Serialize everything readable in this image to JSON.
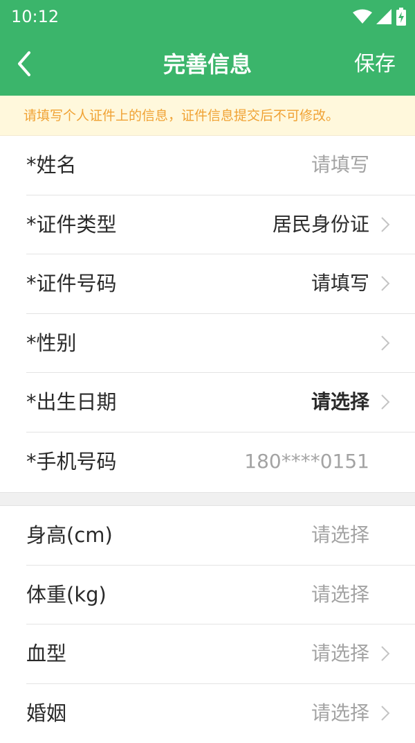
{
  "status_bar": {
    "time": "10:12"
  },
  "header": {
    "title": "完善信息",
    "save_label": "保存"
  },
  "notice": "请填写个人证件上的信息，证件信息提交后不可修改。",
  "section1": [
    {
      "label": "*姓名",
      "value": "请填写",
      "style": "placeholder",
      "chevron": false
    },
    {
      "label": "*证件类型",
      "value": "居民身份证",
      "style": "dark",
      "chevron": true
    },
    {
      "label": "*证件号码",
      "value": "请填写",
      "style": "dark",
      "chevron": true
    },
    {
      "label": "*性别",
      "value": "",
      "style": "placeholder",
      "chevron": true
    },
    {
      "label": "*出生日期",
      "value": "请选择",
      "style": "bold",
      "chevron": true
    },
    {
      "label": "*手机号码",
      "value": "180****0151",
      "style": "placeholder",
      "chevron": false
    }
  ],
  "section2": [
    {
      "label": "身高(cm)",
      "value": "请选择",
      "style": "placeholder",
      "chevron": false
    },
    {
      "label": "体重(kg)",
      "value": "请选择",
      "style": "placeholder",
      "chevron": false
    },
    {
      "label": "血型",
      "value": "请选择",
      "style": "placeholder",
      "chevron": true
    },
    {
      "label": "婚姻",
      "value": "请选择",
      "style": "placeholder",
      "chevron": true
    }
  ],
  "colors": {
    "accent": "#3bb56b",
    "notice_bg": "#fff8dc",
    "notice_text": "#f0a234"
  }
}
